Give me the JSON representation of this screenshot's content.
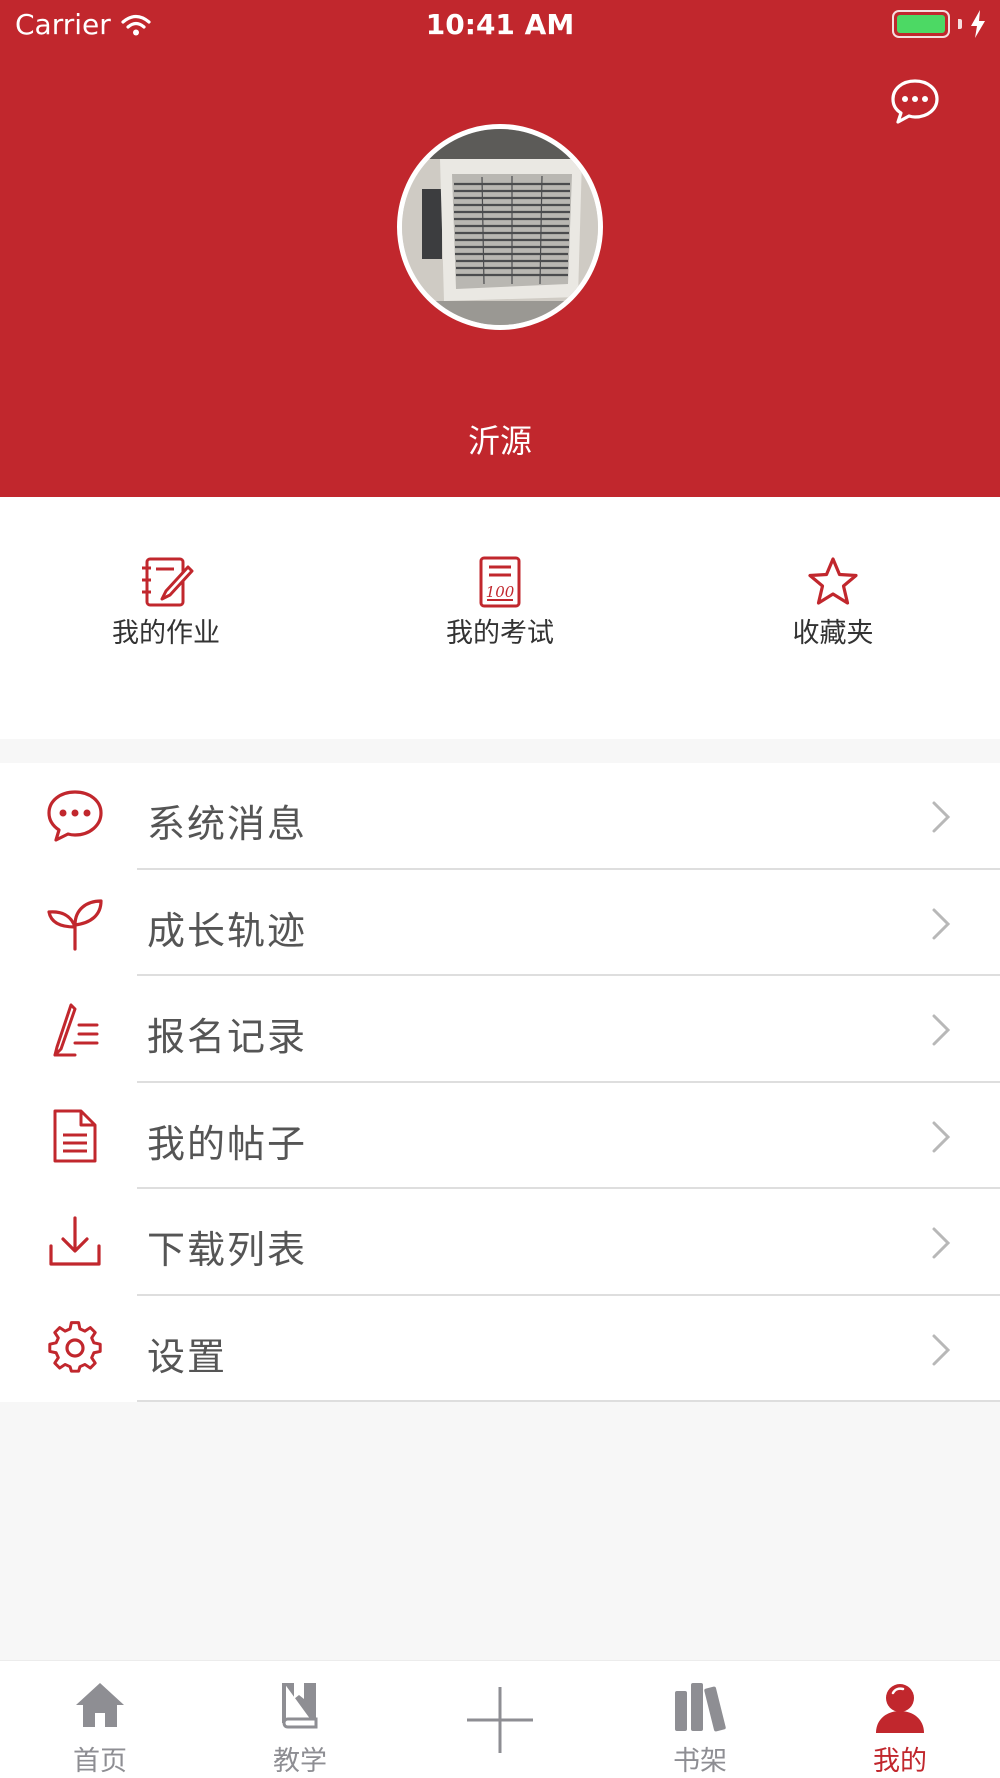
{
  "status_bar": {
    "carrier": "Carrier",
    "time": "10:41 AM",
    "battery_icon": "battery-full-charging-icon"
  },
  "header": {
    "background_color": "#c1272d",
    "message_icon": "chat-bubble-icon",
    "avatar_alt": "avatar",
    "username": "沂源"
  },
  "quick_actions": [
    {
      "label": "我的作业",
      "icon": "notebook-pen-icon"
    },
    {
      "label": "我的考试",
      "icon": "exam-paper-icon"
    },
    {
      "label": "收藏夹",
      "icon": "star-icon"
    }
  ],
  "menu": [
    {
      "label": "系统消息",
      "icon": "chat-bubble-icon"
    },
    {
      "label": "成长轨迹",
      "icon": "sprout-icon"
    },
    {
      "label": "报名记录",
      "icon": "pen-list-icon"
    },
    {
      "label": "我的帖子",
      "icon": "document-icon"
    },
    {
      "label": "下载列表",
      "icon": "download-icon"
    },
    {
      "label": "设置",
      "icon": "gear-icon"
    }
  ],
  "tabbar": {
    "active_color": "#c1272d",
    "inactive_color": "#8e8e93",
    "tabs": [
      {
        "label": "首页",
        "icon": "home-icon",
        "active": false
      },
      {
        "label": "教学",
        "icon": "book-icon",
        "active": false
      },
      {
        "label": "",
        "icon": "plus-icon",
        "active": false
      },
      {
        "label": "书架",
        "icon": "bookshelf-icon",
        "active": false
      },
      {
        "label": "我的",
        "icon": "user-icon",
        "active": true
      }
    ]
  }
}
